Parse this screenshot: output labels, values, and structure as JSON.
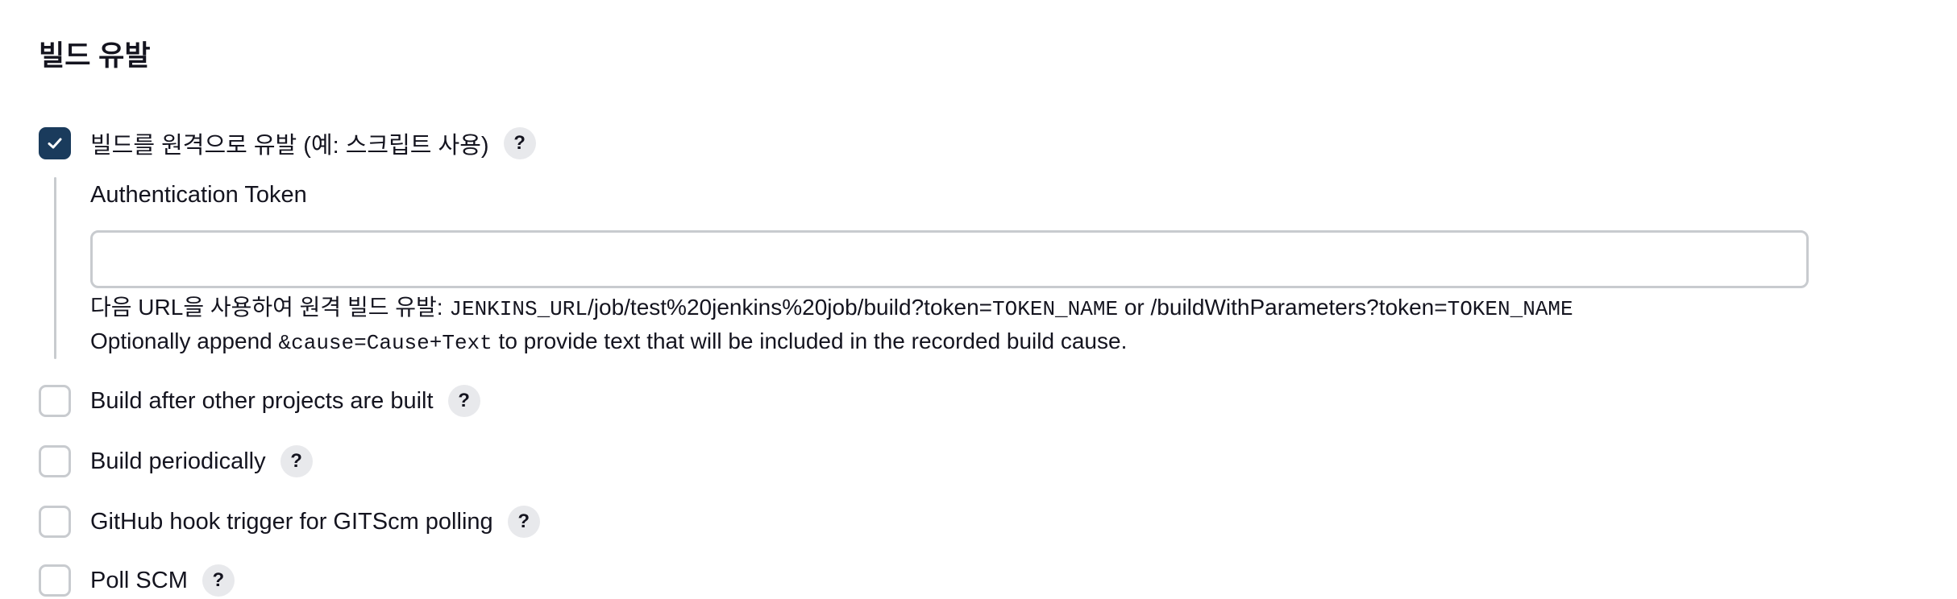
{
  "section": {
    "title": "빌드 유발"
  },
  "options": [
    {
      "label": "빌드를 원격으로 유발 (예: 스크립트 사용)",
      "checked": true,
      "help": "?"
    },
    {
      "label": "Build after other projects are built",
      "checked": false,
      "help": "?"
    },
    {
      "label": "Build periodically",
      "checked": false,
      "help": "?"
    },
    {
      "label": "GitHub hook trigger for GITScm polling",
      "checked": false,
      "help": "?"
    },
    {
      "label": "Poll SCM",
      "checked": false,
      "help": "?"
    }
  ],
  "remote": {
    "field_label": "Authentication Token",
    "input_value": "",
    "desc_line1": {
      "prefix": "다음 URL을 사용하여 원격 빌드 유발: ",
      "code1": "JENKINS_URL",
      "mid1": "/job/test%20jenkins%20job/build?token=",
      "code2": "TOKEN_NAME",
      "mid2": " or /buildWithParameters?token=",
      "code3": "TOKEN_NAME"
    },
    "desc_line2": {
      "prefix": "Optionally append ",
      "code": "&cause=Cause+Text",
      "suffix": " to provide text that will be included in the recorded build cause."
    }
  },
  "colors": {
    "checked_bg": "#1a3b5c",
    "unchecked_border": "#c8cbcf",
    "help_bg": "#e8e9ec",
    "text": "#14141f"
  }
}
